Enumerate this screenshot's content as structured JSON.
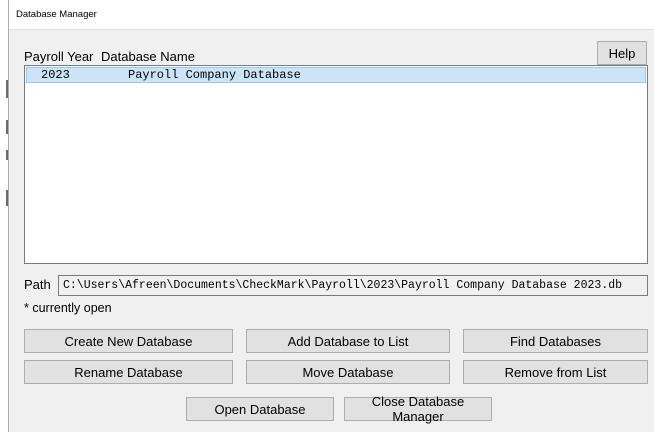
{
  "window": {
    "title": "Database Manager"
  },
  "columns": {
    "year": "Payroll Year",
    "name": "Database Name"
  },
  "help_label": "Help",
  "databases": [
    {
      "year": "2023",
      "name": "Payroll Company Database",
      "selected": true
    }
  ],
  "path": {
    "label": "Path",
    "value": "C:\\Users\\Afreen\\Documents\\CheckMark\\Payroll\\2023\\Payroll Company Database 2023.db"
  },
  "note": "* currently open",
  "buttons": {
    "create_new": "Create New Database",
    "add_to_list": "Add Database to List",
    "find": "Find Databases",
    "rename": "Rename Database",
    "move": "Move Database",
    "remove": "Remove from List",
    "open": "Open Database",
    "close": "Close Database Manager"
  },
  "colors": {
    "selection": "#cce4f7",
    "selection_border": "#99c9ef",
    "button_face": "#e1e1e1",
    "window_bg": "#f0f0f0"
  }
}
